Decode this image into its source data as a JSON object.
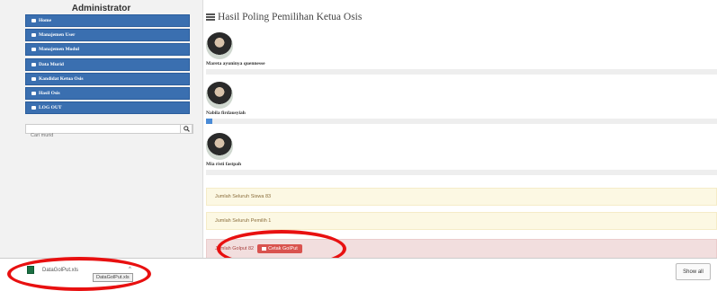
{
  "sidebar": {
    "title": "Administrator",
    "items": [
      {
        "label": "Home",
        "icon": "home-icon"
      },
      {
        "label": "Manajemen User",
        "icon": "users-icon"
      },
      {
        "label": "Manajemen Modul",
        "icon": "modules-icon"
      },
      {
        "label": "Data Murid",
        "icon": "data-icon"
      },
      {
        "label": "Kandidat Ketua Osis",
        "icon": "candidate-icon"
      },
      {
        "label": "Hasil Osis",
        "icon": "results-icon"
      },
      {
        "label": "LOG OUT",
        "icon": "logout-icon"
      }
    ],
    "search": {
      "placeholder": "Cari murid"
    }
  },
  "main": {
    "title": "Hasil Poling Pemilihan Ketua Osis",
    "candidates": [
      {
        "name": "Mareta ayuninya quennesse",
        "votes_fraction": 0.0
      },
      {
        "name": "Nabila firdausyiah",
        "votes_fraction": 0.012
      },
      {
        "name": "Mia risti fastpah",
        "votes_fraction": 0.0
      }
    ],
    "total_siswa": "Jumlah Seluruh Siswa 83",
    "total_pemilih": "Jumlah Seluruh Pemilih 1",
    "golput": "Jumlah Golput 82",
    "cetak_label": "Cetak GolPut"
  },
  "downloads": {
    "file_name": "DataGolPut.xls",
    "tooltip": "DataGolPut.xls",
    "show_all": "Show all"
  },
  "colors": {
    "sidebar_button": "#3a6fb0",
    "annotation": "#e81010",
    "cetak_button": "#d9534f",
    "progress": "#4a8bd6"
  }
}
